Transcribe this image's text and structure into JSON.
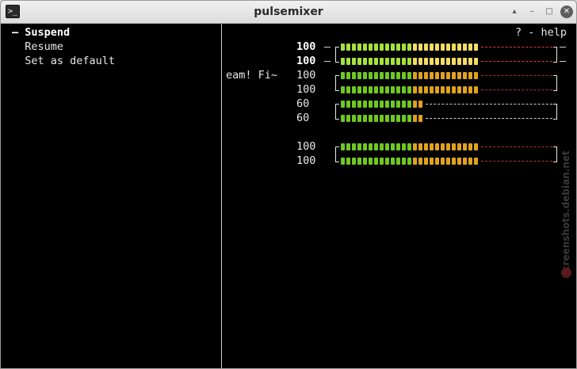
{
  "window": {
    "title": "pulsemixer",
    "icon": "terminal-icon",
    "icon_glyph": ">_",
    "buttons": [
      {
        "name": "restore-up-icon",
        "glyph": "▴"
      },
      {
        "name": "minimize-icon",
        "glyph": "–"
      },
      {
        "name": "maximize-icon",
        "glyph": "□"
      },
      {
        "name": "close-icon",
        "glyph": "✕"
      }
    ]
  },
  "menu": {
    "items": [
      {
        "marker": "–",
        "label": "Suspend",
        "selected": true
      },
      {
        "marker": "",
        "label": "Resume",
        "selected": false
      },
      {
        "marker": "",
        "label": "Set as default",
        "selected": false
      }
    ]
  },
  "help": "? - help",
  "stream_name": "eam! Fi~",
  "colors": {
    "green": "#6ec81e",
    "light_green": "#a6e23a",
    "yellow": "#f3dc62",
    "orange": "#e0a21c",
    "red_dash": "#e23b3b",
    "dark_red_dash": "#b52e2e",
    "white": "#e8e8e8"
  },
  "channels": [
    {
      "volume": "100",
      "level": 1.0,
      "bold": true,
      "palette": "bright"
    },
    {
      "volume": "100",
      "level": 1.0,
      "bold": true,
      "palette": "bright"
    },
    {
      "volume": "100",
      "level": 1.0,
      "bold": false,
      "palette": "dim"
    },
    {
      "volume": "100",
      "level": 1.0,
      "bold": false,
      "palette": "dim"
    },
    {
      "volume": "60",
      "level": 0.6,
      "bold": false,
      "palette": "dim"
    },
    {
      "volume": "60",
      "level": 0.6,
      "bold": false,
      "palette": "dim"
    },
    {
      "volume": "100",
      "level": 1.0,
      "bold": false,
      "palette": "dim"
    },
    {
      "volume": "100",
      "level": 1.0,
      "bold": false,
      "palette": "dim"
    }
  ],
  "watermark": "screenshots.debian.net"
}
